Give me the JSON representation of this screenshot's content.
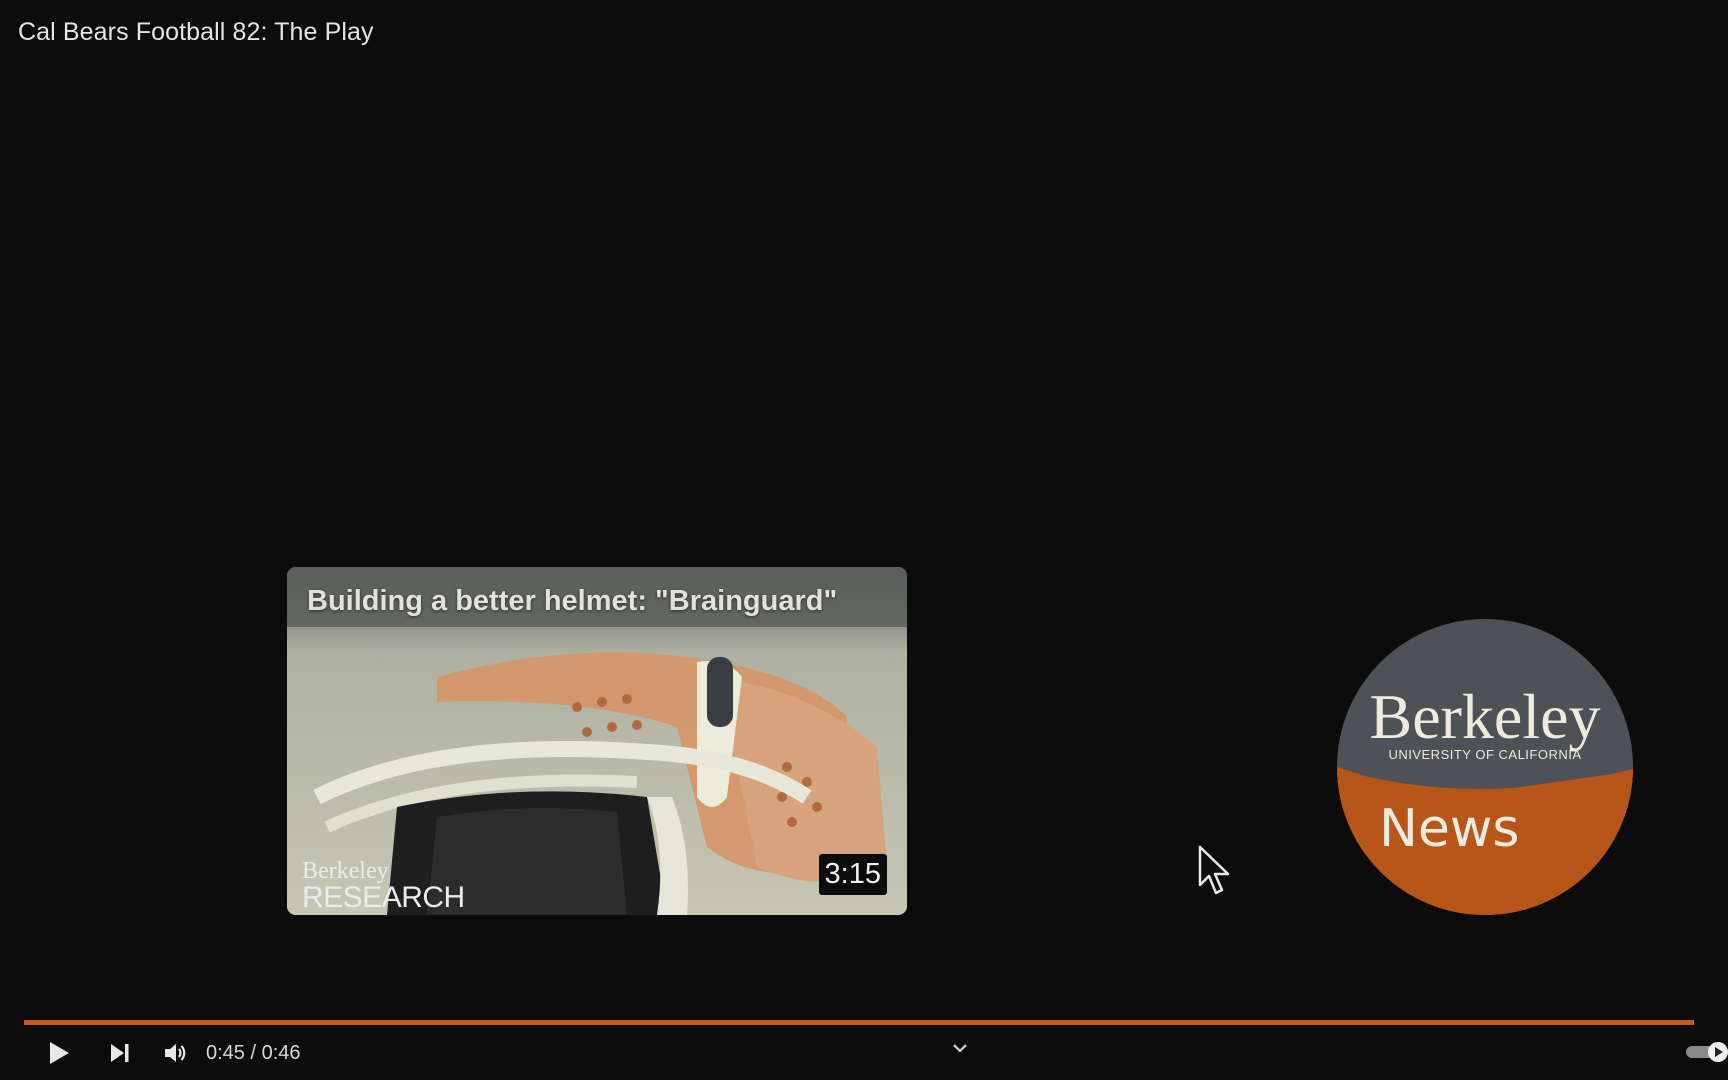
{
  "player": {
    "video_title": "Cal Bears Football 82: The Play",
    "time_display": "0:45 / 0:46",
    "progress_fraction": 0.98,
    "accent_color": "#c85a1a"
  },
  "endscreen": {
    "card": {
      "title": "Building a better helmet: \"Brainguard\"",
      "duration": "3:15",
      "brand_line1": "Berkeley",
      "brand_line2": "RESEARCH"
    },
    "channel_logo": {
      "wordmark": "Berkeley",
      "subtitle": "UNIVERSITY OF CALIFORNIA",
      "label": "News",
      "colors": {
        "top": "#4e5256",
        "bottom": "#b8561a"
      }
    }
  },
  "controls": {
    "icons": [
      "play-icon",
      "next-icon",
      "volume-icon",
      "chevron-down-icon",
      "autoplay-toggle"
    ]
  }
}
